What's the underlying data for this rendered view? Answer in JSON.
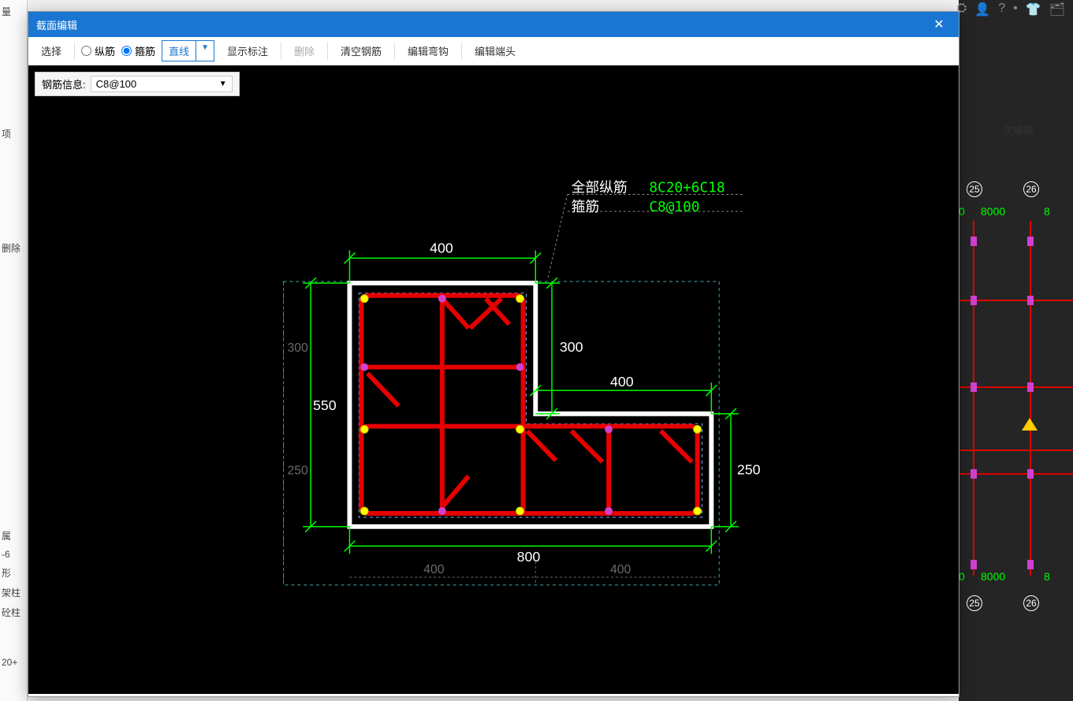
{
  "dialog": {
    "title": "截面编辑",
    "toolbar": {
      "select": "选择",
      "longitudinal": "纵筋",
      "stirrup": "箍筋",
      "line_mode": "直线",
      "show_label": "显示标注",
      "delete": "删除",
      "clear": "清空钢筋",
      "edit_hook": "编辑弯钩",
      "edit_end": "编辑端头"
    },
    "info": {
      "label": "钢筋信息:",
      "value": "C8@100"
    }
  },
  "drawing": {
    "annotation": {
      "all_long_label": "全部纵筋",
      "all_long_value": "8C20+6C18",
      "stirrup_label": "箍筋",
      "stirrup_value": "C8@100"
    },
    "dims": {
      "top_400": "400",
      "right_300": "300",
      "right_400": "400",
      "right_250": "250",
      "left_300": "300",
      "left_550": "550",
      "left_250": "250",
      "bottom_800": "800",
      "bottom_400a": "400",
      "bottom_400b": "400"
    }
  },
  "background": {
    "edit_label": "次编辑",
    "axes": [
      "25",
      "26",
      "25",
      "26"
    ],
    "spans": [
      "0",
      "8000",
      "8",
      "0",
      "8000",
      "8"
    ],
    "left_items": [
      "量",
      "项",
      "删除",
      "属",
      "-6",
      "形",
      "架柱",
      "砼柱",
      "20+"
    ]
  },
  "top_icons": [
    "⛭",
    "👤",
    "?",
    "•",
    "👕",
    "🗂"
  ]
}
